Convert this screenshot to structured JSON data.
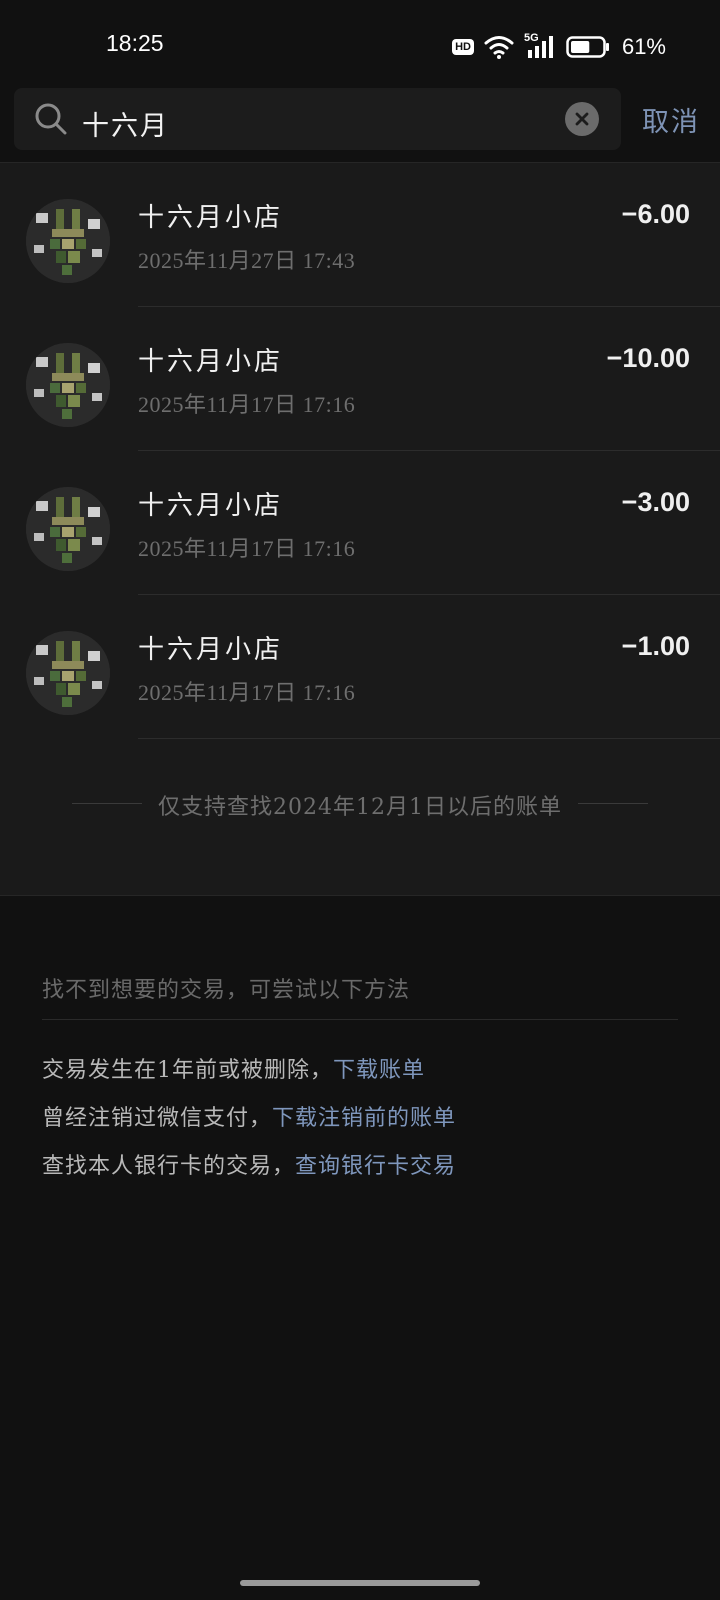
{
  "status_bar": {
    "time": "18:25",
    "hd_label": "HD",
    "network_label": "5G",
    "battery_percent": "61%",
    "battery_level": 0.61,
    "icons": [
      "hd-icon",
      "wifi-icon",
      "signal-5g-icon",
      "battery-icon"
    ]
  },
  "search": {
    "value": "十六月",
    "cancel_label": "取消",
    "icons": [
      "search-icon",
      "clear-icon"
    ]
  },
  "transactions": [
    {
      "merchant": "十六月小店",
      "time": "2025年11月27日  17:43",
      "amount": "−6.00"
    },
    {
      "merchant": "十六月小店",
      "time": "2025年11月17日  17:16",
      "amount": "−10.00"
    },
    {
      "merchant": "十六月小店",
      "time": "2025年11月17日  17:16",
      "amount": "−3.00"
    },
    {
      "merchant": "十六月小店",
      "time": "2025年11月17日  17:16",
      "amount": "−1.00"
    }
  ],
  "notice": "仅支持查找2024年12月1日以后的账单",
  "help": {
    "title": "找不到想要的交易，可尝试以下方法",
    "items": [
      {
        "text": "交易发生在1年前或被删除，",
        "link": "下载账单"
      },
      {
        "text": "曾经注销过微信支付，",
        "link": "下载注销前的账单"
      },
      {
        "text": "查找本人银行卡的交易，",
        "link": "查询银行卡交易"
      }
    ]
  },
  "colors": {
    "background": "#111111",
    "panel": "#1a1a1a",
    "link": "#7f97bd",
    "secondary_text": "#6e6e6e"
  }
}
